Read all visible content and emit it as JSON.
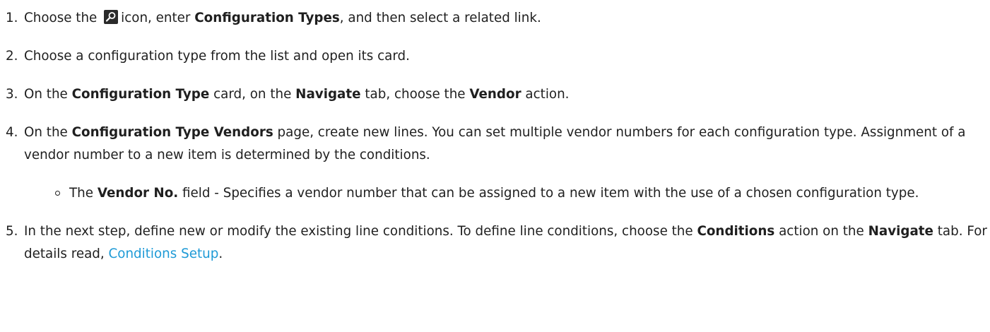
{
  "steps": [
    {
      "number": "1.",
      "pre": "Choose the",
      "icon": "search-icon",
      "mid": "icon, enter",
      "bold1": "Configuration Types",
      "post": ", and then select a related link."
    },
    {
      "number": "2.",
      "text": "Choose a configuration type from the list and open its card."
    },
    {
      "number": "3.",
      "pre": "On the",
      "bold1": "Configuration Type",
      "mid1": "card, on the",
      "bold2": "Navigate",
      "mid2": "tab, choose the",
      "bold3": "Vendor",
      "post": "action."
    },
    {
      "number": "4.",
      "pre": "On the",
      "bold1": "Configuration Type Vendors",
      "post": "page, create new lines. You can set multiple vendor numbers for each configuration type. Assignment of a vendor number to a new item is determined by the conditions.",
      "sub": {
        "pre": "The",
        "bold": "Vendor No.",
        "post": "field - Specifies a vendor number that can be assigned to a new item with the use of a chosen configuration type."
      }
    },
    {
      "number": "5.",
      "pre": "In the next step, define new or modify the existing line conditions. To define line conditions, choose the",
      "bold1": "Conditions",
      "mid1": "action on the",
      "bold2": "Navigate",
      "mid2": "tab. For details read,",
      "link": "Conditions Setup",
      "post": "."
    }
  ]
}
